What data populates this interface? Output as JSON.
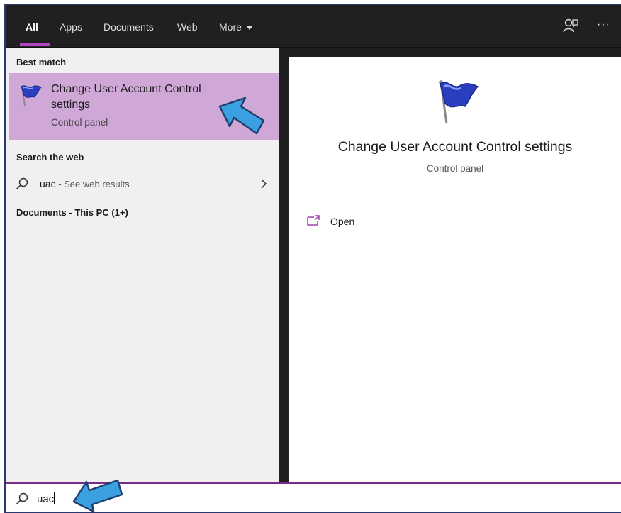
{
  "tabs": [
    {
      "label": "All",
      "active": true
    },
    {
      "label": "Apps"
    },
    {
      "label": "Documents"
    },
    {
      "label": "Web"
    },
    {
      "label": "More"
    }
  ],
  "header_icons": {
    "feedback": "feedback-icon",
    "more": "more-options-icon",
    "more_glyph": "···"
  },
  "results": {
    "best_match_header": "Best match",
    "best_match": {
      "title": "Change User Account Control settings",
      "subtitle": "Control panel",
      "icon": "uac-flag-icon"
    },
    "web_header": "Search the web",
    "web_item": {
      "query": "uac",
      "suffix": " - See web results"
    },
    "documents_header": "Documents - This PC (1+)"
  },
  "preview": {
    "title": "Change User Account Control settings",
    "subtitle": "Control panel",
    "actions": [
      {
        "label": "Open",
        "icon": "open-icon"
      }
    ]
  },
  "search": {
    "value": "uac"
  },
  "colors": {
    "accent": "#b146c2",
    "highlight": "#cfa8d7",
    "annotation_arrow": "#3aa0e0",
    "tab_bar": "#202020"
  }
}
